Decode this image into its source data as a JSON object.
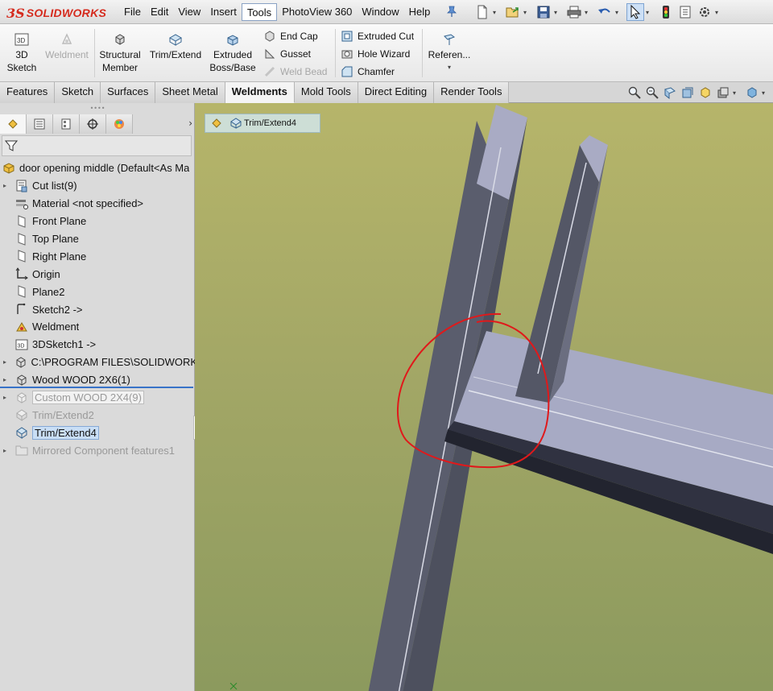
{
  "app": {
    "logo_ds": "3S",
    "logo_name": "SOLIDWORKS"
  },
  "menus": [
    "File",
    "Edit",
    "View",
    "Insert",
    "Tools",
    "PhotoView 360",
    "Window",
    "Help"
  ],
  "active_menu": "Tools",
  "quick_access": [
    "new-doc-icon",
    "open-icon",
    "save-icon",
    "print-icon",
    "undo-icon",
    "select-icon",
    "rebuild-icon",
    "file-properties-icon",
    "options-icon"
  ],
  "command_manager": {
    "sketch3d": "3D\nSketch",
    "weldment": "Weldment",
    "structural_member": "Structural\nMember",
    "trim_extend": "Trim/Extend",
    "extruded_boss": "Extruded\nBoss/Base",
    "end_cap": "End Cap",
    "gusset": "Gusset",
    "weld_bead": "Weld Bead",
    "extruded_cut": "Extruded Cut",
    "hole_wizard": "Hole Wizard",
    "chamfer": "Chamfer",
    "reference": "Referen..."
  },
  "tabs": [
    "Features",
    "Sketch",
    "Surfaces",
    "Sheet Metal",
    "Weldments",
    "Mold Tools",
    "Direct Editing",
    "Render Tools"
  ],
  "active_tab": "Weldments",
  "tree": {
    "root": "door opening middle  (Default<As Ma",
    "items": [
      {
        "label": "Cut list(9)"
      },
      {
        "label": "Material <not specified>"
      },
      {
        "label": "Front Plane"
      },
      {
        "label": "Top Plane"
      },
      {
        "label": "Right Plane"
      },
      {
        "label": "Origin"
      },
      {
        "label": "Plane2"
      },
      {
        "label": "Sketch2 ->"
      },
      {
        "label": "Weldment"
      },
      {
        "label": "3DSketch1 ->"
      },
      {
        "label": "C:\\PROGRAM FILES\\SOLIDWORKS"
      },
      {
        "label": "Wood WOOD 2X6(1)"
      },
      {
        "label": "Custom WOOD 2X4(9)"
      },
      {
        "label": "Trim/Extend2"
      },
      {
        "label": "Trim/Extend4"
      },
      {
        "label": "Mirrored Component features1"
      }
    ]
  },
  "breadcrumb": {
    "label": "Trim/Extend4"
  },
  "colors": {
    "accent": "#3873c8",
    "logo": "#d52b1e",
    "annotation": "#e0191b"
  }
}
